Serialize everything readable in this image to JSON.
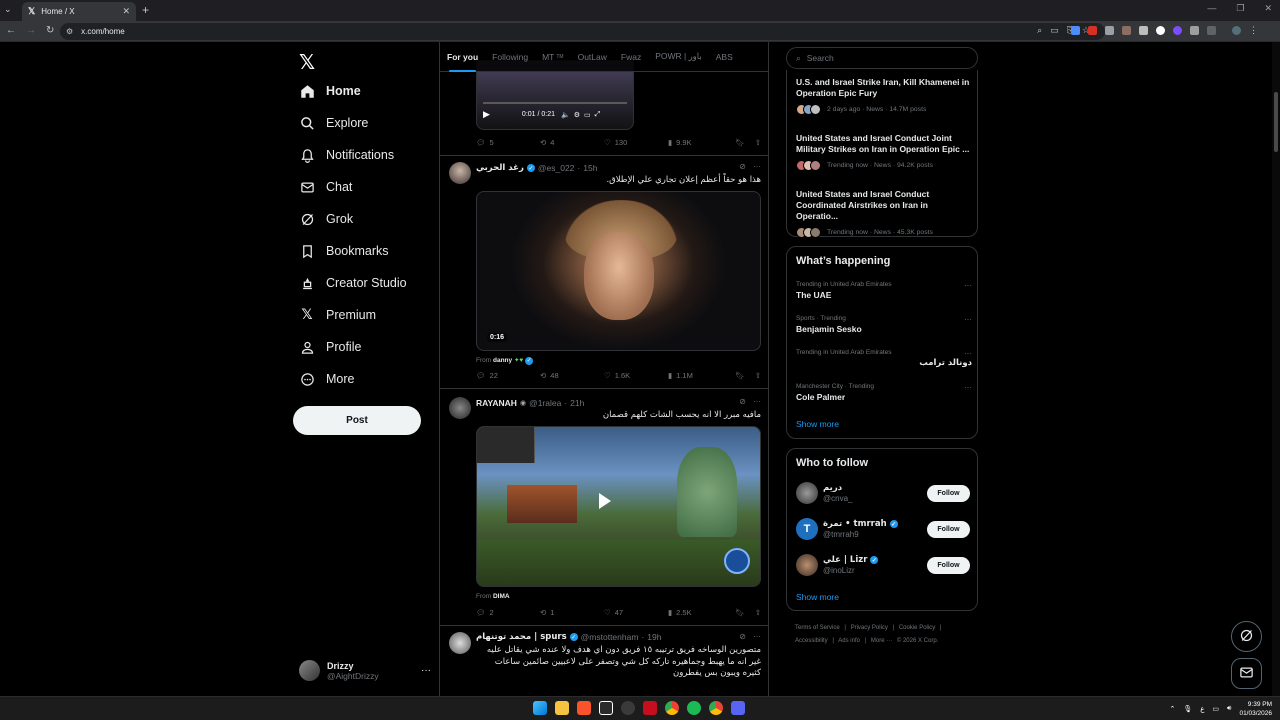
{
  "browser": {
    "tab_title": "Home / X",
    "url": "x.com/home"
  },
  "sidebar": {
    "items": [
      {
        "label": "Home",
        "icon": "home-icon"
      },
      {
        "label": "Explore",
        "icon": "search-icon"
      },
      {
        "label": "Notifications",
        "icon": "bell-icon"
      },
      {
        "label": "Chat",
        "icon": "mail-icon"
      },
      {
        "label": "Grok",
        "icon": "grok-icon"
      },
      {
        "label": "Bookmarks",
        "icon": "bookmark-icon"
      },
      {
        "label": "Creator Studio",
        "icon": "creator-studio-icon"
      },
      {
        "label": "Premium",
        "icon": "x-logo-icon"
      },
      {
        "label": "Profile",
        "icon": "person-icon"
      },
      {
        "label": "More",
        "icon": "more-circle-icon"
      }
    ],
    "post_label": "Post",
    "account": {
      "name": "Drizzy",
      "handle": "@AightDrizzy"
    }
  },
  "timeline": {
    "tabs": [
      "For you",
      "Following",
      "MT",
      "OutLaw",
      "Fwaz",
      "POWR | باور",
      "ABS"
    ],
    "mt_badge": "TM",
    "tweet0": {
      "time": "0:01 / 0:21",
      "replies": "5",
      "reposts": "4",
      "likes": "130",
      "views": "9.9K"
    },
    "tweet1": {
      "name": "رغد الحربي",
      "handle": "@es_022",
      "time": "15h",
      "text": "هذا هو حقاً أعظم إعلان تجاري علي الإطلاق.",
      "duration": "0:16",
      "from_label": "From",
      "from_name": "danny",
      "replies": "22",
      "reposts": "48",
      "likes": "1.6K",
      "views": "1.1M"
    },
    "tweet2": {
      "name": "RAYANAH",
      "handle": "@1ralea",
      "time": "21h",
      "text": "مافيه مبرر الا انه يحسب الشات كلهم قصمان",
      "from_label": "From",
      "from_name": "DIMA",
      "replies": "2",
      "reposts": "1",
      "likes": "47",
      "views": "2.5K"
    },
    "tweet3": {
      "name": "محمد توتنهام | spurs",
      "handle": "@mstottenham",
      "time": "19h",
      "text": "متصورين الوساخه فريق ترتيبه ١٥ فريق دون اي هدف ولا عنده شي يقاتل عليه غير انه ما يهبط وجماهيره تاركه كل شي وتصفر على لاعبيين صائمين ساعات كثيره ويبون بس يفطرون"
    }
  },
  "right": {
    "search_placeholder": "Search",
    "news": [
      {
        "title": "U.S. and Israel Strike Iran, Kill Khamenei in Operation Epic Fury",
        "meta": "2 days ago · News · 14.7M posts"
      },
      {
        "title": "United States and Israel Conduct Joint Military Strikes on Iran in Operation Epic ...",
        "meta": "Trending now · News · 94.2K posts"
      },
      {
        "title": "United States and Israel Conduct Coordinated Airstrikes on Iran in Operatio...",
        "meta": "Trending now · News · 45.3K posts"
      }
    ],
    "happening": {
      "title": "What’s happening",
      "trends": [
        {
          "context": "Trending in United Arab Emirates",
          "name": "The UAE"
        },
        {
          "context": "Sports · Trending",
          "name": "Benjamin Sesko"
        },
        {
          "context": "Trending in United Arab Emirates",
          "name": "دونالد ترامب"
        },
        {
          "context": "Manchester City · Trending",
          "name": "Cole Palmer"
        }
      ],
      "show_more": "Show more"
    },
    "who_to_follow": {
      "title": "Who to follow",
      "users": [
        {
          "name": "دريم",
          "handle": "@cnva_",
          "button": "Follow"
        },
        {
          "name": "تمرة • tmrrah",
          "handle": "@tmrrah9",
          "button": "Follow"
        },
        {
          "name": "علي | Lizr",
          "handle": "@inoLizr",
          "button": "Follow"
        }
      ],
      "show_more": "Show more"
    },
    "footer": [
      "Terms of Service",
      "|",
      "Privacy Policy",
      "|",
      "Cookie Policy",
      "|",
      "Accessibility",
      "|",
      "Ads info",
      "|",
      "More ···",
      "© 2026 X Corp."
    ]
  },
  "taskbar": {
    "time": "9:39 PM",
    "date": "01/03/2026",
    "lang": "ع"
  },
  "colors": {
    "accent": "#1d9bf0",
    "background": "#000000",
    "border": "#2f3336",
    "muted": "#71767b"
  }
}
